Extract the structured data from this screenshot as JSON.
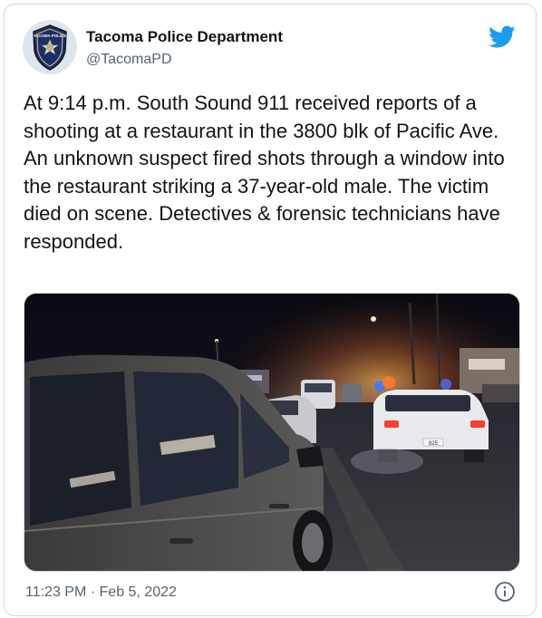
{
  "author": {
    "name": "Tacoma Police Department",
    "handle": "@TacomaPD",
    "avatar_badge_text": "TACOMA POLICE"
  },
  "tweet": {
    "text": "At 9:14 p.m. South Sound 911 received reports of a shooting at a restaurant in the 3800 blk of Pacific Ave. An unknown suspect fired shots through a window into the restaurant striking a 37-year-old male. The victim died on scene. Detectives & forensic technicians have responded."
  },
  "media": {
    "plate_text": "825"
  },
  "meta": {
    "timestamp": "11:23 PM · Feb 5, 2022"
  },
  "icons": {
    "logo": "twitter-bird-icon",
    "info": "info-icon"
  },
  "colors": {
    "brand": "#1d9bf0",
    "text": "#0f1419",
    "muted": "#536471",
    "border": "#cfd9de"
  }
}
